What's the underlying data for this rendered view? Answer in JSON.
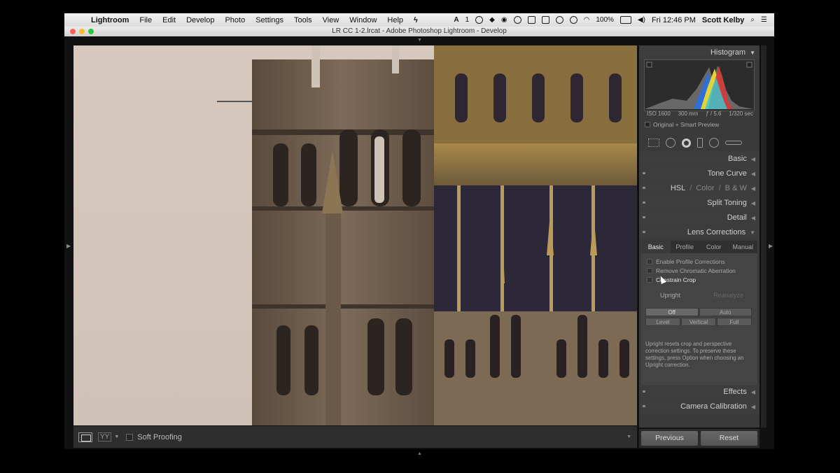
{
  "menubar": {
    "app": "Lightroom",
    "items": [
      "File",
      "Edit",
      "Develop",
      "Photo",
      "Settings",
      "Tools",
      "View",
      "Window",
      "Help"
    ],
    "status_num": "1",
    "battery": "100%",
    "clock": "Fri 12:46 PM",
    "user": "Scott Kelby"
  },
  "window": {
    "title": "LR CC 1-2.lrcat - Adobe Photoshop Lightroom - Develop"
  },
  "toolbar": {
    "view_modes": "YY",
    "soft_proofing_label": "Soft Proofing"
  },
  "histogram": {
    "title": "Histogram",
    "iso": "ISO 1600",
    "focal": "300 mm",
    "aperture": "ƒ / 5.6",
    "shutter": "1/320 sec",
    "preview": "Original + Smart Preview"
  },
  "panels": {
    "basic": "Basic",
    "tone_curve": "Tone Curve",
    "hsl": "HSL",
    "color": "Color",
    "bw": "B & W",
    "split_toning": "Split Toning",
    "detail": "Detail",
    "lens_corrections": "Lens Corrections",
    "effects": "Effects",
    "camera_calibration": "Camera Calibration"
  },
  "lens": {
    "tabs": [
      "Basic",
      "Profile",
      "Color",
      "Manual"
    ],
    "options": [
      "Enable Profile Corrections",
      "Remove Chromatic Aberration",
      "Constrain Crop"
    ],
    "upright_label": "Upright",
    "reanalyze_label": "Reanalyze",
    "row1": [
      "Off",
      "Auto"
    ],
    "row2": [
      "Level",
      "Vertical",
      "Full"
    ],
    "note": "Upright resets crop and perspective correction settings. To preserve these settings, press Option when choosing an Upright correction."
  },
  "buttons": {
    "previous": "Previous",
    "reset": "Reset"
  }
}
